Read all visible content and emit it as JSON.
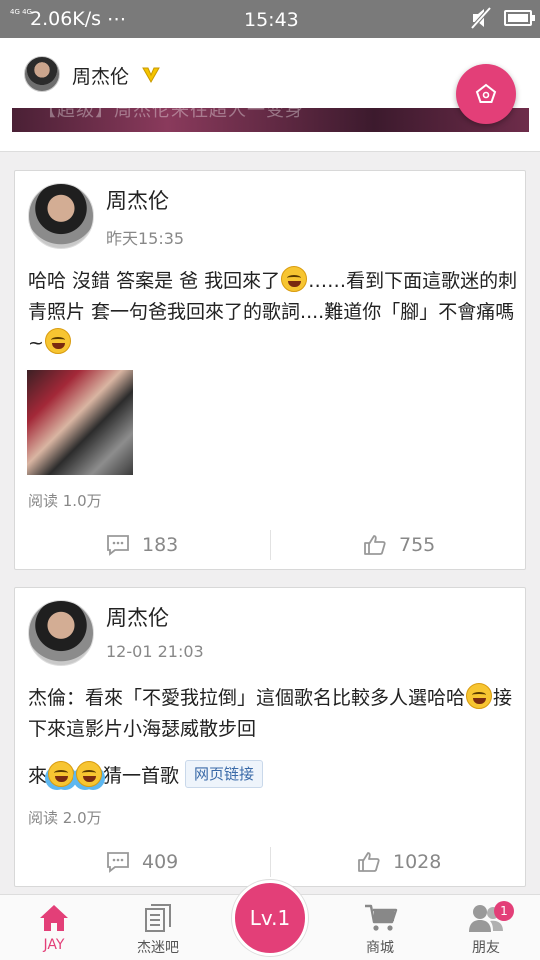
{
  "status_bar": {
    "network": "4G 4G",
    "speed": "2.06K/s ⋯",
    "time": "15:43"
  },
  "header": {
    "name": "周杰伦",
    "banner_text": "【超级】周杰伦来往超人一变身"
  },
  "posts": [
    {
      "author": "周杰伦",
      "time": "昨天15:35",
      "text_1": "哈哈 沒錯 答案是 爸 我回來了",
      "text_2": "……看到下面這歌迷的刺青照片 套一句爸我回來了的歌詞....難道你「腳」不會痛嗎~",
      "reads": "阅读 1.0万",
      "comments": "183",
      "likes": "755"
    },
    {
      "author": "周杰伦",
      "time": "12-01 21:03",
      "text_1": "杰倫：看來「不愛我拉倒」這個歌名比較多人選哈哈",
      "text_2": "接下來這影片小海瑟威散步回",
      "text_3": "來",
      "text_4": "猜一首歌",
      "link_label": "网页链接",
      "reads": "阅读 2.0万",
      "comments": "409",
      "likes": "1028"
    }
  ],
  "bottom_nav": {
    "items": [
      {
        "label": "JAY",
        "icon": "home-icon"
      },
      {
        "label": "杰迷吧",
        "icon": "forum-icon"
      },
      {
        "label": "Lv.1",
        "icon": "level-button"
      },
      {
        "label": "商城",
        "icon": "cart-icon"
      },
      {
        "label": "朋友",
        "icon": "friends-icon",
        "badge": "1"
      }
    ]
  },
  "colors": {
    "accent": "#e33f78",
    "status_bar": "#7a7a7a",
    "link": "#3a6aa8"
  }
}
